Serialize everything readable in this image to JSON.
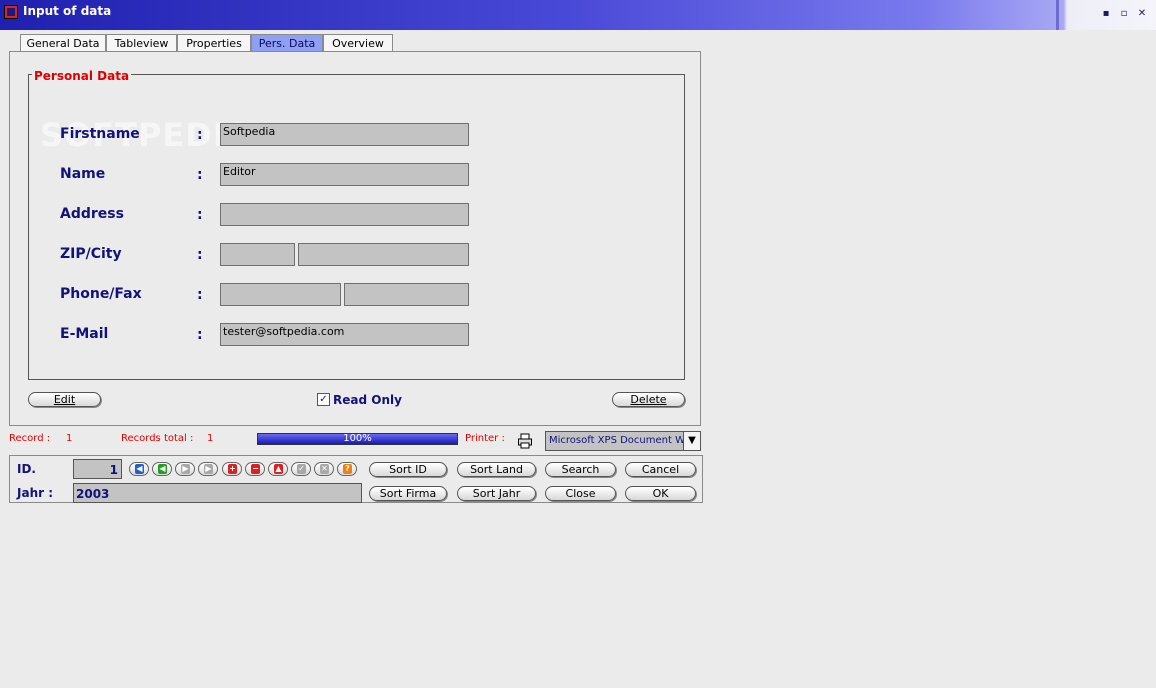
{
  "window": {
    "title": "Input of data",
    "min": "▪",
    "max": "▫",
    "close": "✕"
  },
  "tabs": [
    {
      "label": "General Data"
    },
    {
      "label": "Tableview"
    },
    {
      "label": "Properties"
    },
    {
      "label": "Pers. Data"
    },
    {
      "label": "Overview"
    }
  ],
  "form": {
    "group_title": "Personal Data",
    "watermark": "SOFTPEDIA",
    "colon": ":",
    "firstname": {
      "label": "Firstname",
      "value": "Softpedia"
    },
    "name": {
      "label": "Name",
      "value": "Editor"
    },
    "address": {
      "label": "Address",
      "value": ""
    },
    "zip_city": {
      "label": "ZIP/City",
      "zip": "",
      "city": ""
    },
    "phone_fax": {
      "label": "Phone/Fax",
      "phone": "",
      "fax": ""
    },
    "email": {
      "label": "E-Mail",
      "value": "tester@softpedia.com"
    },
    "edit_label": "Edit",
    "delete_label": "Delete",
    "read_only_label": "Read Only",
    "read_only_checked": "✓"
  },
  "status": {
    "record_label": "Record :",
    "record_value": "1",
    "records_total_label": "Records total :",
    "records_total_value": "1",
    "progress_text": "100%",
    "progress_fraction": 1.0,
    "printer_label": "Printer :",
    "printer_value": "Microsoft XPS Document W",
    "dropdown_arrow": "▼"
  },
  "nav": {
    "id_label": "ID.",
    "id_value": "1",
    "jahr_label": "Jahr :",
    "jahr_value": "2003",
    "buttons": {
      "sort_id": "Sort ID",
      "sort_land": "Sort Land",
      "search": "Search",
      "cancel": "Cancel",
      "sort_firma": "Sort Firma",
      "sort_jahr": "Sort Jahr",
      "close": "Close",
      "ok": "OK"
    },
    "glyphs": {
      "first": "◀",
      "prev": "◀",
      "next": "▶",
      "last": "▶",
      "add": "+",
      "remove": "−",
      "up": "▲",
      "check": "✓",
      "x": "✕",
      "question": "?"
    }
  },
  "colors": {
    "accent": "#12127a",
    "red": "#e00000",
    "field": "#c3c3c3",
    "tab_active": "#8f9ff4"
  }
}
